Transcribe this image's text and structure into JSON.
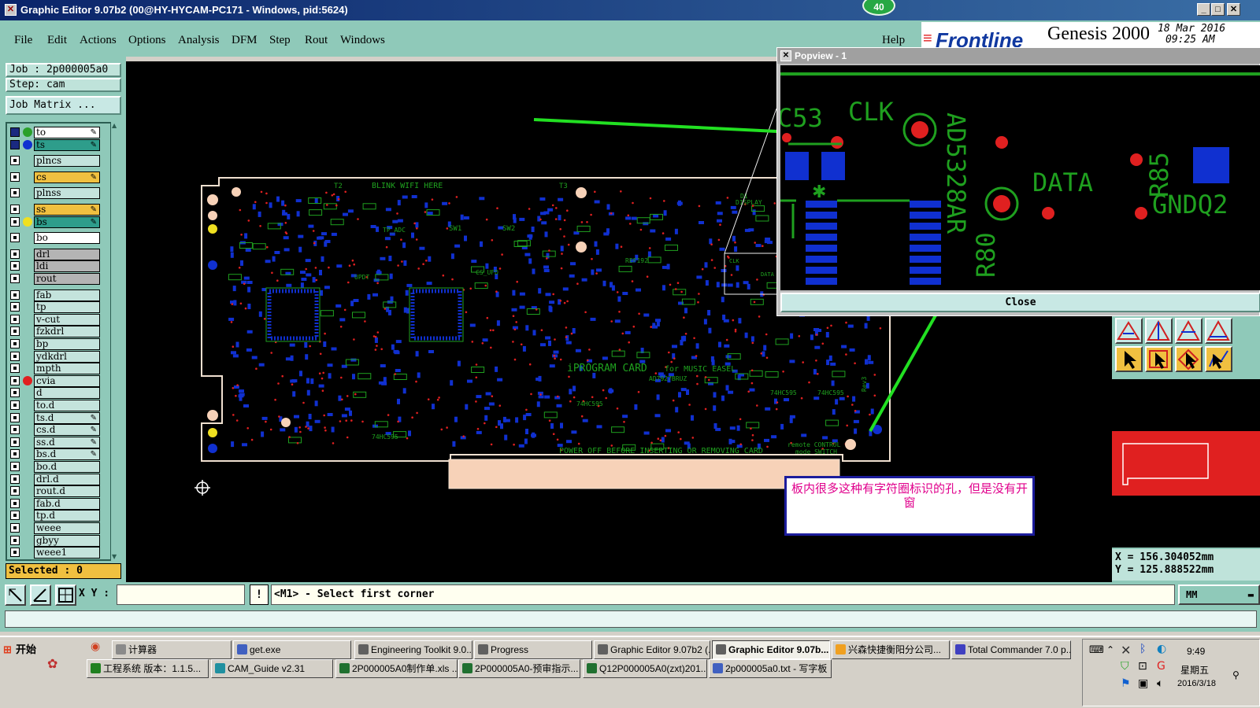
{
  "window": {
    "title": "Graphic Editor 9.07b2 (00@HY-HYCAM-PC171 - Windows, pid:5624)",
    "badge": "40"
  },
  "menu": {
    "items": [
      "File",
      "Edit",
      "Actions",
      "Options",
      "Analysis",
      "DFM",
      "Step",
      "Rout",
      "Windows"
    ],
    "help": "Help"
  },
  "brand": {
    "logo": "Frontline",
    "product": "Genesis 2000",
    "date": "18 Mar 2016",
    "time": "09:25 AM"
  },
  "left": {
    "job": "Job : 2p000005a0",
    "step": "Step: cam",
    "job_matrix": "Job Matrix ...",
    "selected": "Selected : 0",
    "layers": [
      {
        "name": "to",
        "style": "white",
        "dot": "#2aa02a",
        "checked": true,
        "pen": true
      },
      {
        "name": "ts",
        "style": "teal",
        "dot": "#1030d0",
        "checked": true,
        "pen": true
      },
      {
        "name": "plncs",
        "style": "",
        "dot": "",
        "checked": false,
        "pen": false
      },
      {
        "name": "cs",
        "style": "yellow",
        "dot": "",
        "checked": false,
        "pen": true
      },
      {
        "name": "plnss",
        "style": "",
        "dot": "",
        "checked": false,
        "pen": false
      },
      {
        "name": "ss",
        "style": "yellow",
        "dot": "",
        "checked": false,
        "pen": true
      },
      {
        "name": "bs",
        "style": "teal",
        "dot": "#f0e020",
        "checked": false,
        "pen": true
      },
      {
        "name": "bo",
        "style": "white",
        "dot": "",
        "checked": false,
        "pen": false
      },
      {
        "name": "drl",
        "style": "gray",
        "dot": "",
        "checked": false,
        "pen": false
      },
      {
        "name": "ldi",
        "style": "gray",
        "dot": "",
        "checked": false,
        "pen": false
      },
      {
        "name": "rout",
        "style": "gray",
        "dot": "",
        "checked": false,
        "pen": false
      },
      {
        "name": "fab",
        "style": "",
        "dot": "",
        "checked": false,
        "pen": false
      },
      {
        "name": "tp",
        "style": "",
        "dot": "",
        "checked": false,
        "pen": false
      },
      {
        "name": "v-cut",
        "style": "",
        "dot": "",
        "checked": false,
        "pen": false
      },
      {
        "name": "fzkdrl",
        "style": "",
        "dot": "",
        "checked": false,
        "pen": false
      },
      {
        "name": "bp",
        "style": "",
        "dot": "",
        "checked": false,
        "pen": false
      },
      {
        "name": "ydkdrl",
        "style": "",
        "dot": "",
        "checked": false,
        "pen": false
      },
      {
        "name": "mpth",
        "style": "",
        "dot": "",
        "checked": false,
        "pen": false
      },
      {
        "name": "cvia",
        "style": "",
        "dot": "#e02020",
        "checked": false,
        "pen": false
      },
      {
        "name": "d",
        "style": "",
        "dot": "",
        "checked": false,
        "pen": false
      },
      {
        "name": "to.d",
        "style": "",
        "dot": "",
        "checked": false,
        "pen": false
      },
      {
        "name": "ts.d",
        "style": "",
        "dot": "",
        "checked": false,
        "pen": true
      },
      {
        "name": "cs.d",
        "style": "",
        "dot": "",
        "checked": false,
        "pen": true
      },
      {
        "name": "ss.d",
        "style": "",
        "dot": "",
        "checked": false,
        "pen": true
      },
      {
        "name": "bs.d",
        "style": "",
        "dot": "",
        "checked": false,
        "pen": true
      },
      {
        "name": "bo.d",
        "style": "",
        "dot": "",
        "checked": false,
        "pen": false
      },
      {
        "name": "drl.d",
        "style": "",
        "dot": "",
        "checked": false,
        "pen": false
      },
      {
        "name": "rout.d",
        "style": "",
        "dot": "",
        "checked": false,
        "pen": false
      },
      {
        "name": "fab.d",
        "style": "",
        "dot": "",
        "checked": false,
        "pen": false
      },
      {
        "name": "tp.d",
        "style": "",
        "dot": "",
        "checked": false,
        "pen": false
      },
      {
        "name": "weee",
        "style": "",
        "dot": "",
        "checked": false,
        "pen": false
      },
      {
        "name": "gbyy",
        "style": "",
        "dot": "",
        "checked": false,
        "pen": false
      },
      {
        "name": "weee1",
        "style": "",
        "dot": "",
        "checked": false,
        "pen": false
      }
    ]
  },
  "board": {
    "silkscreen": [
      "BLINK WIFI HERE",
      "iPROGRAM CARD",
      "for MUSIC EASEL",
      "POWER OFF BEFORE INSERTING OR REMOVING CARD",
      "remote CONTROL",
      "mode SWITCH",
      "AD7927BRUZ",
      "74HC595",
      "74HC595",
      "74HC595",
      "74HC595",
      "REF192",
      "SW1",
      "SW2",
      "T2",
      "T3",
      "TP_ADC",
      "UPDT",
      "CS_UFD",
      "Rev3",
      "D1",
      "DISPLAY",
      "CLK",
      "DATA"
    ]
  },
  "popview": {
    "title": "Popview - 1",
    "close": "Close",
    "labels": [
      "C53",
      "CLK",
      "AD5328AR",
      "DATA",
      "GNDQ2",
      "R80",
      "R85"
    ]
  },
  "annotation": {
    "text": "板内很多这种有字符圈标识的孔，但是没有开窗"
  },
  "right": {
    "x": "X = 156.304052mm",
    "y": "Y = 125.888522mm"
  },
  "status": {
    "xy_label": "X Y :",
    "xy_value": "",
    "info": "!",
    "prompt": "<M1> - Select first corner",
    "unit": "MM"
  },
  "taskbar": {
    "start": "开始",
    "row1": [
      "计算器",
      "get.exe",
      "Engineering Toolkit 9.0...",
      "Progress",
      "Graphic Editor 9.07b2 (...",
      "Graphic Editor 9.07b...",
      "兴森快捷衡阳分公司...",
      "Total Commander 7.0 p..."
    ],
    "row2": [
      "工程系统  版本：1.1.5...",
      "CAM_Guide v2.31",
      "2P000005A0制作单.xls ...",
      "2P000005A0-预审指示...",
      "Q12P000005A0(zxt)201...",
      "2p000005a0.txt - 写字板"
    ],
    "clock": "9:49",
    "weekday": "星期五",
    "date": "2016/3/18"
  },
  "colors": {
    "pcb_silk": "#1fa01f",
    "pcb_pad": "#1030d0",
    "pcb_via": "#e02020",
    "teal": "#8fc9b9",
    "arrow": "#22e022"
  }
}
